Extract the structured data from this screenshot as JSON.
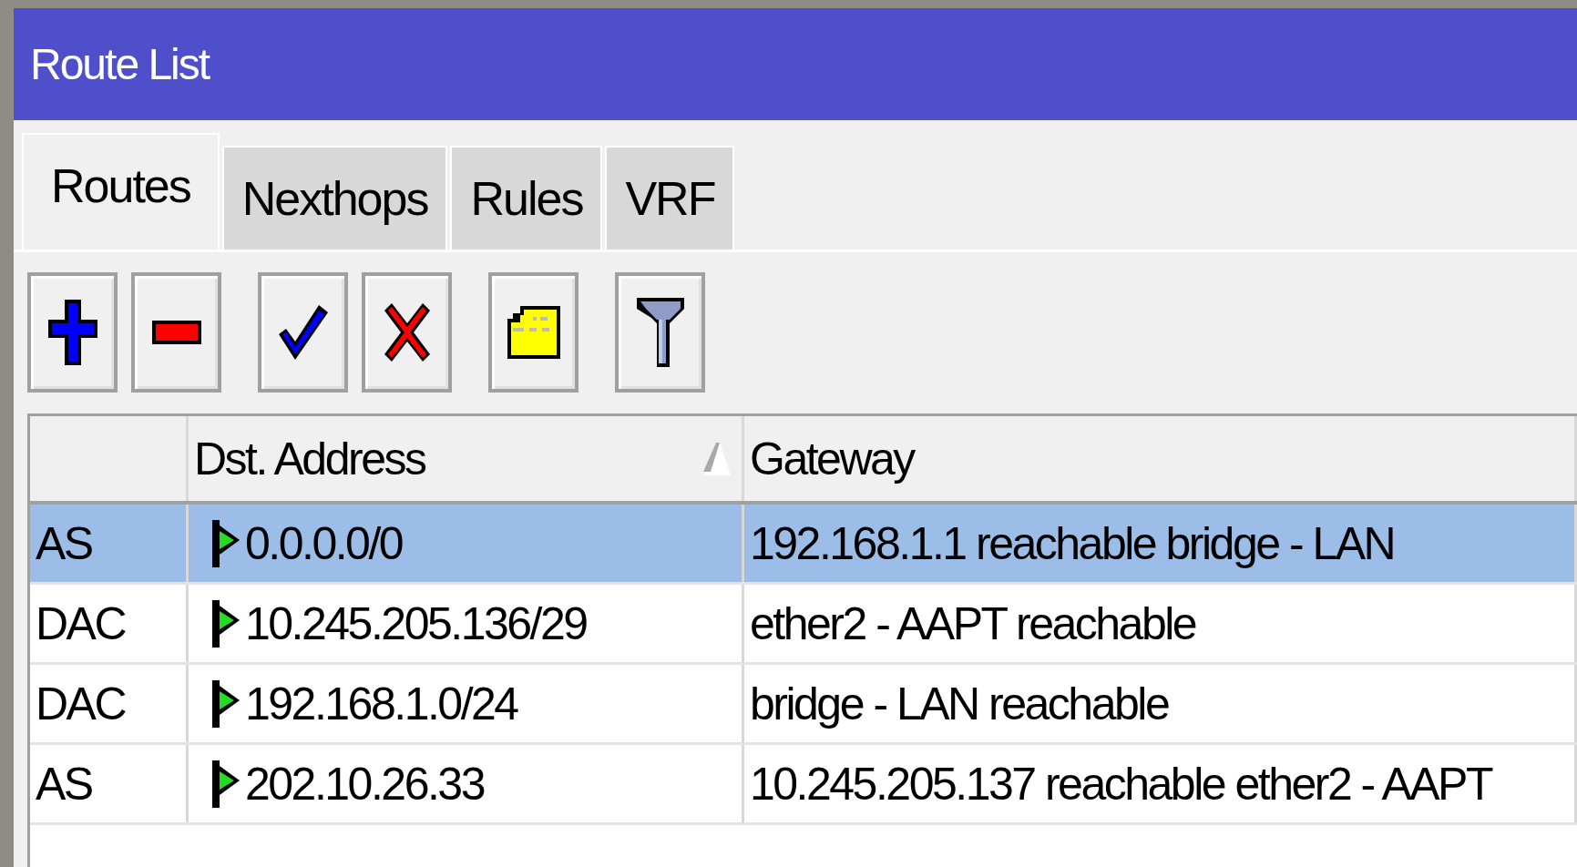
{
  "window": {
    "title": "Route List"
  },
  "tabs": [
    {
      "label": "Routes",
      "selected": true
    },
    {
      "label": "Nexthops",
      "selected": false
    },
    {
      "label": "Rules",
      "selected": false
    },
    {
      "label": "VRF",
      "selected": false
    }
  ],
  "toolbar": [
    {
      "kind": "add"
    },
    {
      "kind": "remove"
    },
    {
      "kind": "enable"
    },
    {
      "kind": "disable"
    },
    {
      "kind": "comment"
    },
    {
      "kind": "filter"
    }
  ],
  "table": {
    "columns": [
      {
        "label": "Dst. Address",
        "sorted": true
      },
      {
        "label": "Gateway",
        "sorted": false
      }
    ],
    "rows": [
      {
        "flags": "AS",
        "dst_address": "0.0.0.0/0",
        "gateway": "192.168.1.1 reachable bridge - LAN",
        "selected": true
      },
      {
        "flags": "DAC",
        "dst_address": "10.245.205.136/29",
        "gateway": "ether2 - AAPT reachable",
        "selected": false
      },
      {
        "flags": "DAC",
        "dst_address": "192.168.1.0/24",
        "gateway": "bridge - LAN reachable",
        "selected": false
      },
      {
        "flags": "AS",
        "dst_address": "202.10.26.33",
        "gateway": "10.245.205.137 reachable ether2 - AAPT",
        "selected": false
      }
    ]
  }
}
